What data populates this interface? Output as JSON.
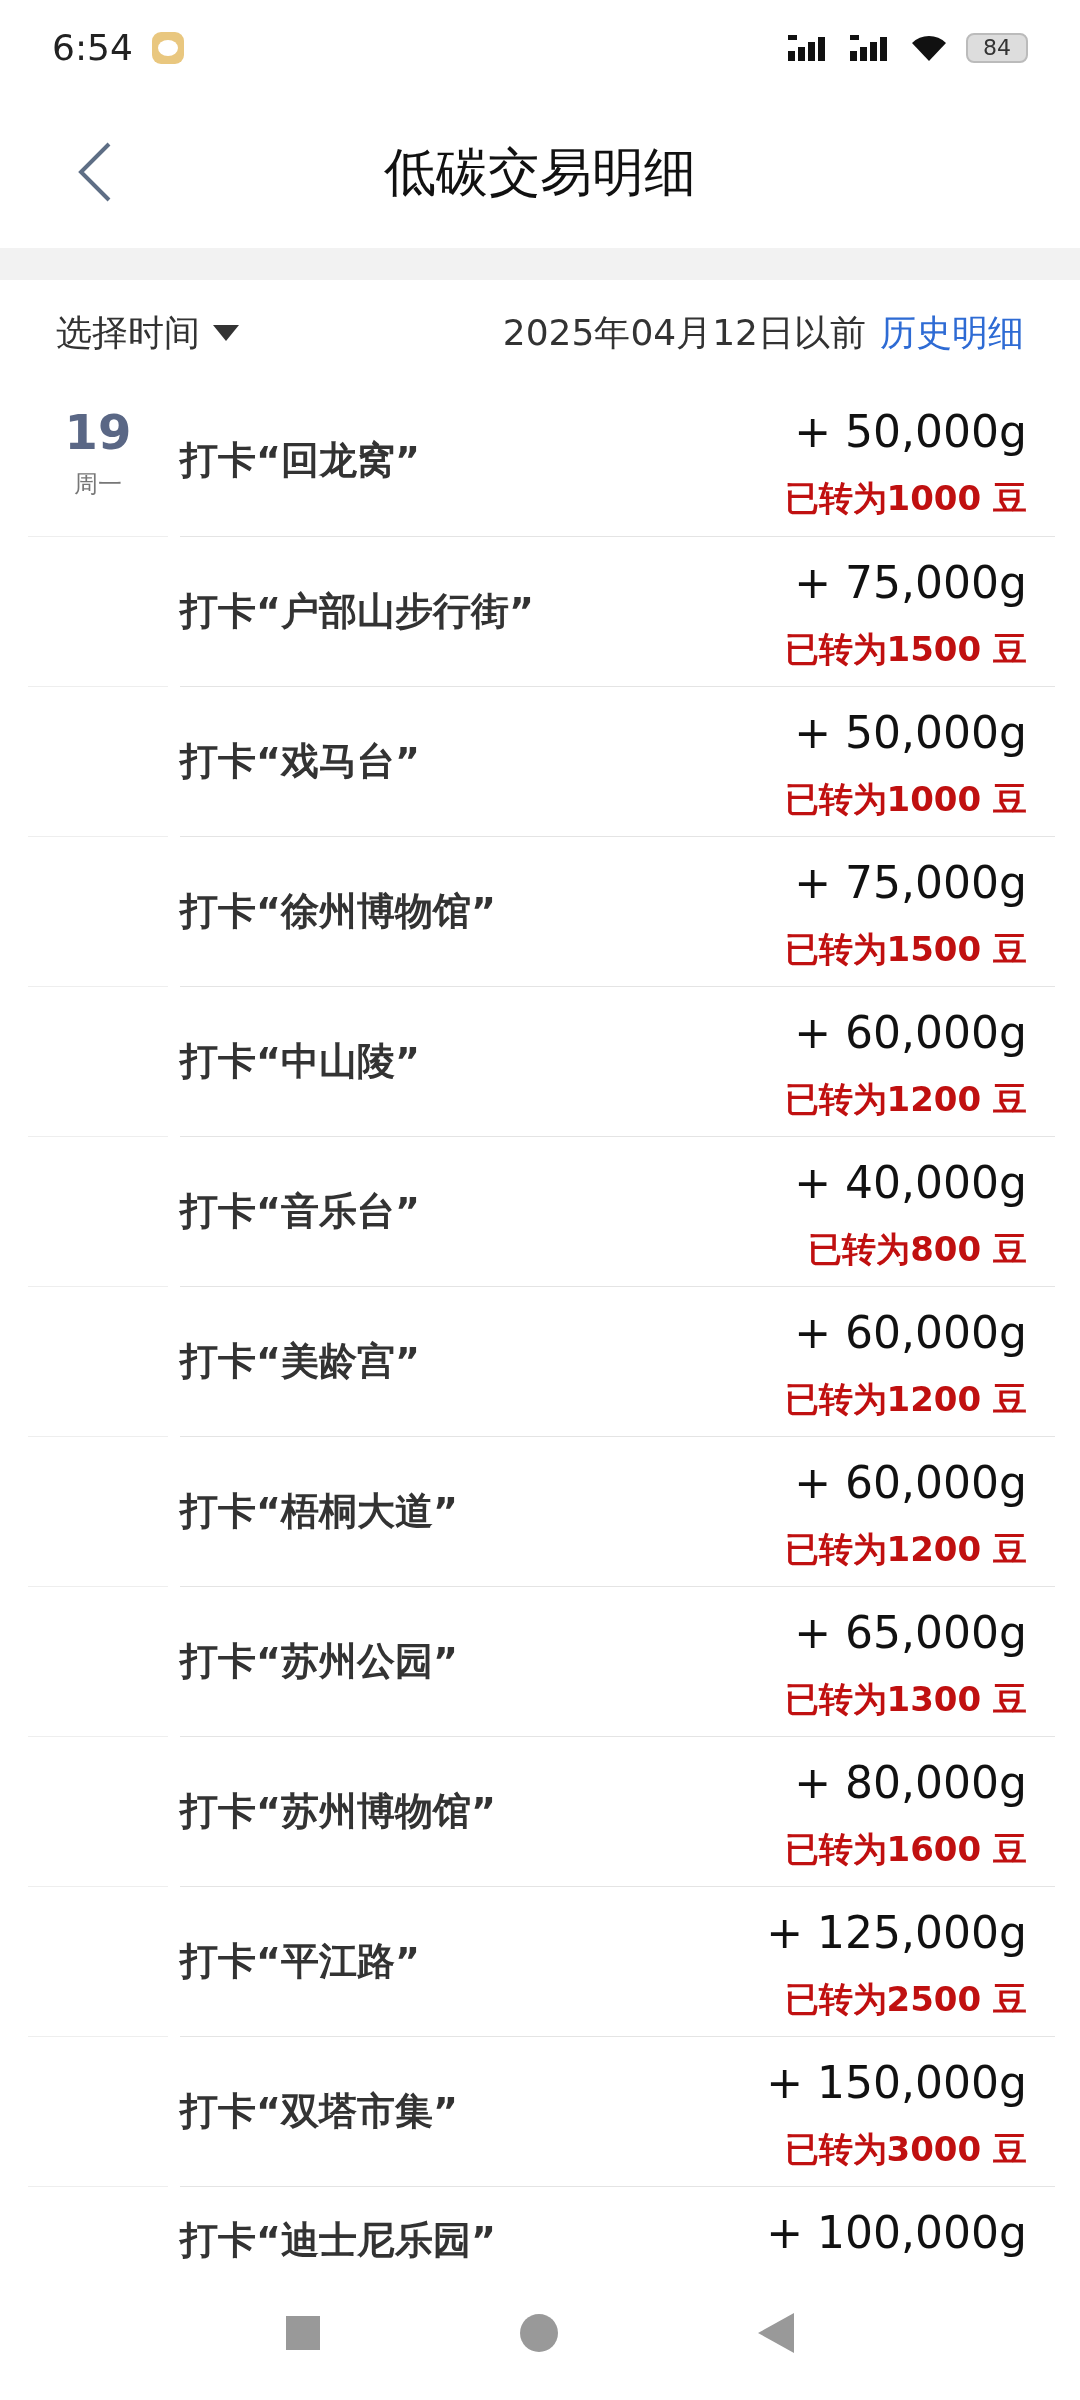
{
  "status_bar": {
    "time": "6:54",
    "battery": "84"
  },
  "header": {
    "title": "低碳交易明细"
  },
  "filter": {
    "label": "选择时间",
    "cutoff": "2025年04月12日以前",
    "history_link": "历史明细"
  },
  "entries": [
    {
      "day": "19",
      "weekday": "周一",
      "title": "打卡“回龙窝”",
      "amount": "+ 50,000g",
      "converted": "已转为1000 豆"
    },
    {
      "title": "打卡“户部山步行街”",
      "amount": "+ 75,000g",
      "converted": "已转为1500 豆"
    },
    {
      "title": "打卡“戏马台”",
      "amount": "+ 50,000g",
      "converted": "已转为1000 豆"
    },
    {
      "title": "打卡“徐州博物馆”",
      "amount": "+ 75,000g",
      "converted": "已转为1500 豆"
    },
    {
      "title": "打卡“中山陵”",
      "amount": "+ 60,000g",
      "converted": "已转为1200 豆"
    },
    {
      "title": "打卡“音乐台”",
      "amount": "+ 40,000g",
      "converted": "已转为800 豆"
    },
    {
      "title": "打卡“美龄宫”",
      "amount": "+ 60,000g",
      "converted": "已转为1200 豆"
    },
    {
      "title": "打卡“梧桐大道”",
      "amount": "+ 60,000g",
      "converted": "已转为1200 豆"
    },
    {
      "title": "打卡“苏州公园”",
      "amount": "+ 65,000g",
      "converted": "已转为1300 豆"
    },
    {
      "title": "打卡“苏州博物馆”",
      "amount": "+ 80,000g",
      "converted": "已转为1600 豆"
    },
    {
      "title": "打卡“平江路”",
      "amount": "+ 125,000g",
      "converted": "已转为2500 豆"
    },
    {
      "title": "打卡“双塔市集”",
      "amount": "+ 150,000g",
      "converted": "已转为3000 豆"
    },
    {
      "title": "打卡“迪士尼乐园”",
      "amount": "+ 100,000g"
    }
  ]
}
